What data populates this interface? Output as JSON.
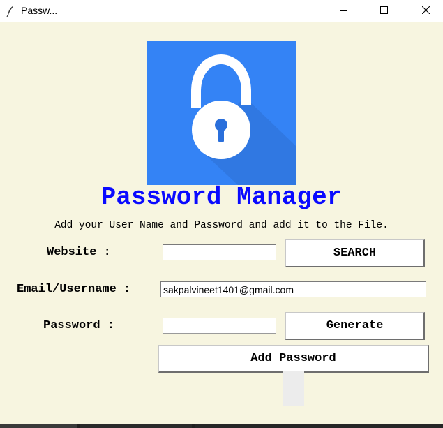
{
  "window": {
    "title": "Passw...",
    "app_icon": "feather-icon",
    "controls": [
      "minimize-icon",
      "maximize-icon",
      "close-icon"
    ]
  },
  "logo": {
    "icon": "padlock-icon",
    "background_color": "#3483f5"
  },
  "heading": "Password Manager",
  "subtitle": "Add your User Name and Password and add it to the File.",
  "form": {
    "website_label": "Website :",
    "website_value": "",
    "search_button": "SEARCH",
    "email_label": "Email/Username :",
    "email_value": "sakpalvineet1401@gmail.com",
    "password_label": "Password :",
    "password_value": "",
    "generate_button": "Generate",
    "add_button": "Add Password"
  },
  "colors": {
    "background": "#f7f5e0",
    "heading": "#0a0aff",
    "button": "#ffffff"
  }
}
